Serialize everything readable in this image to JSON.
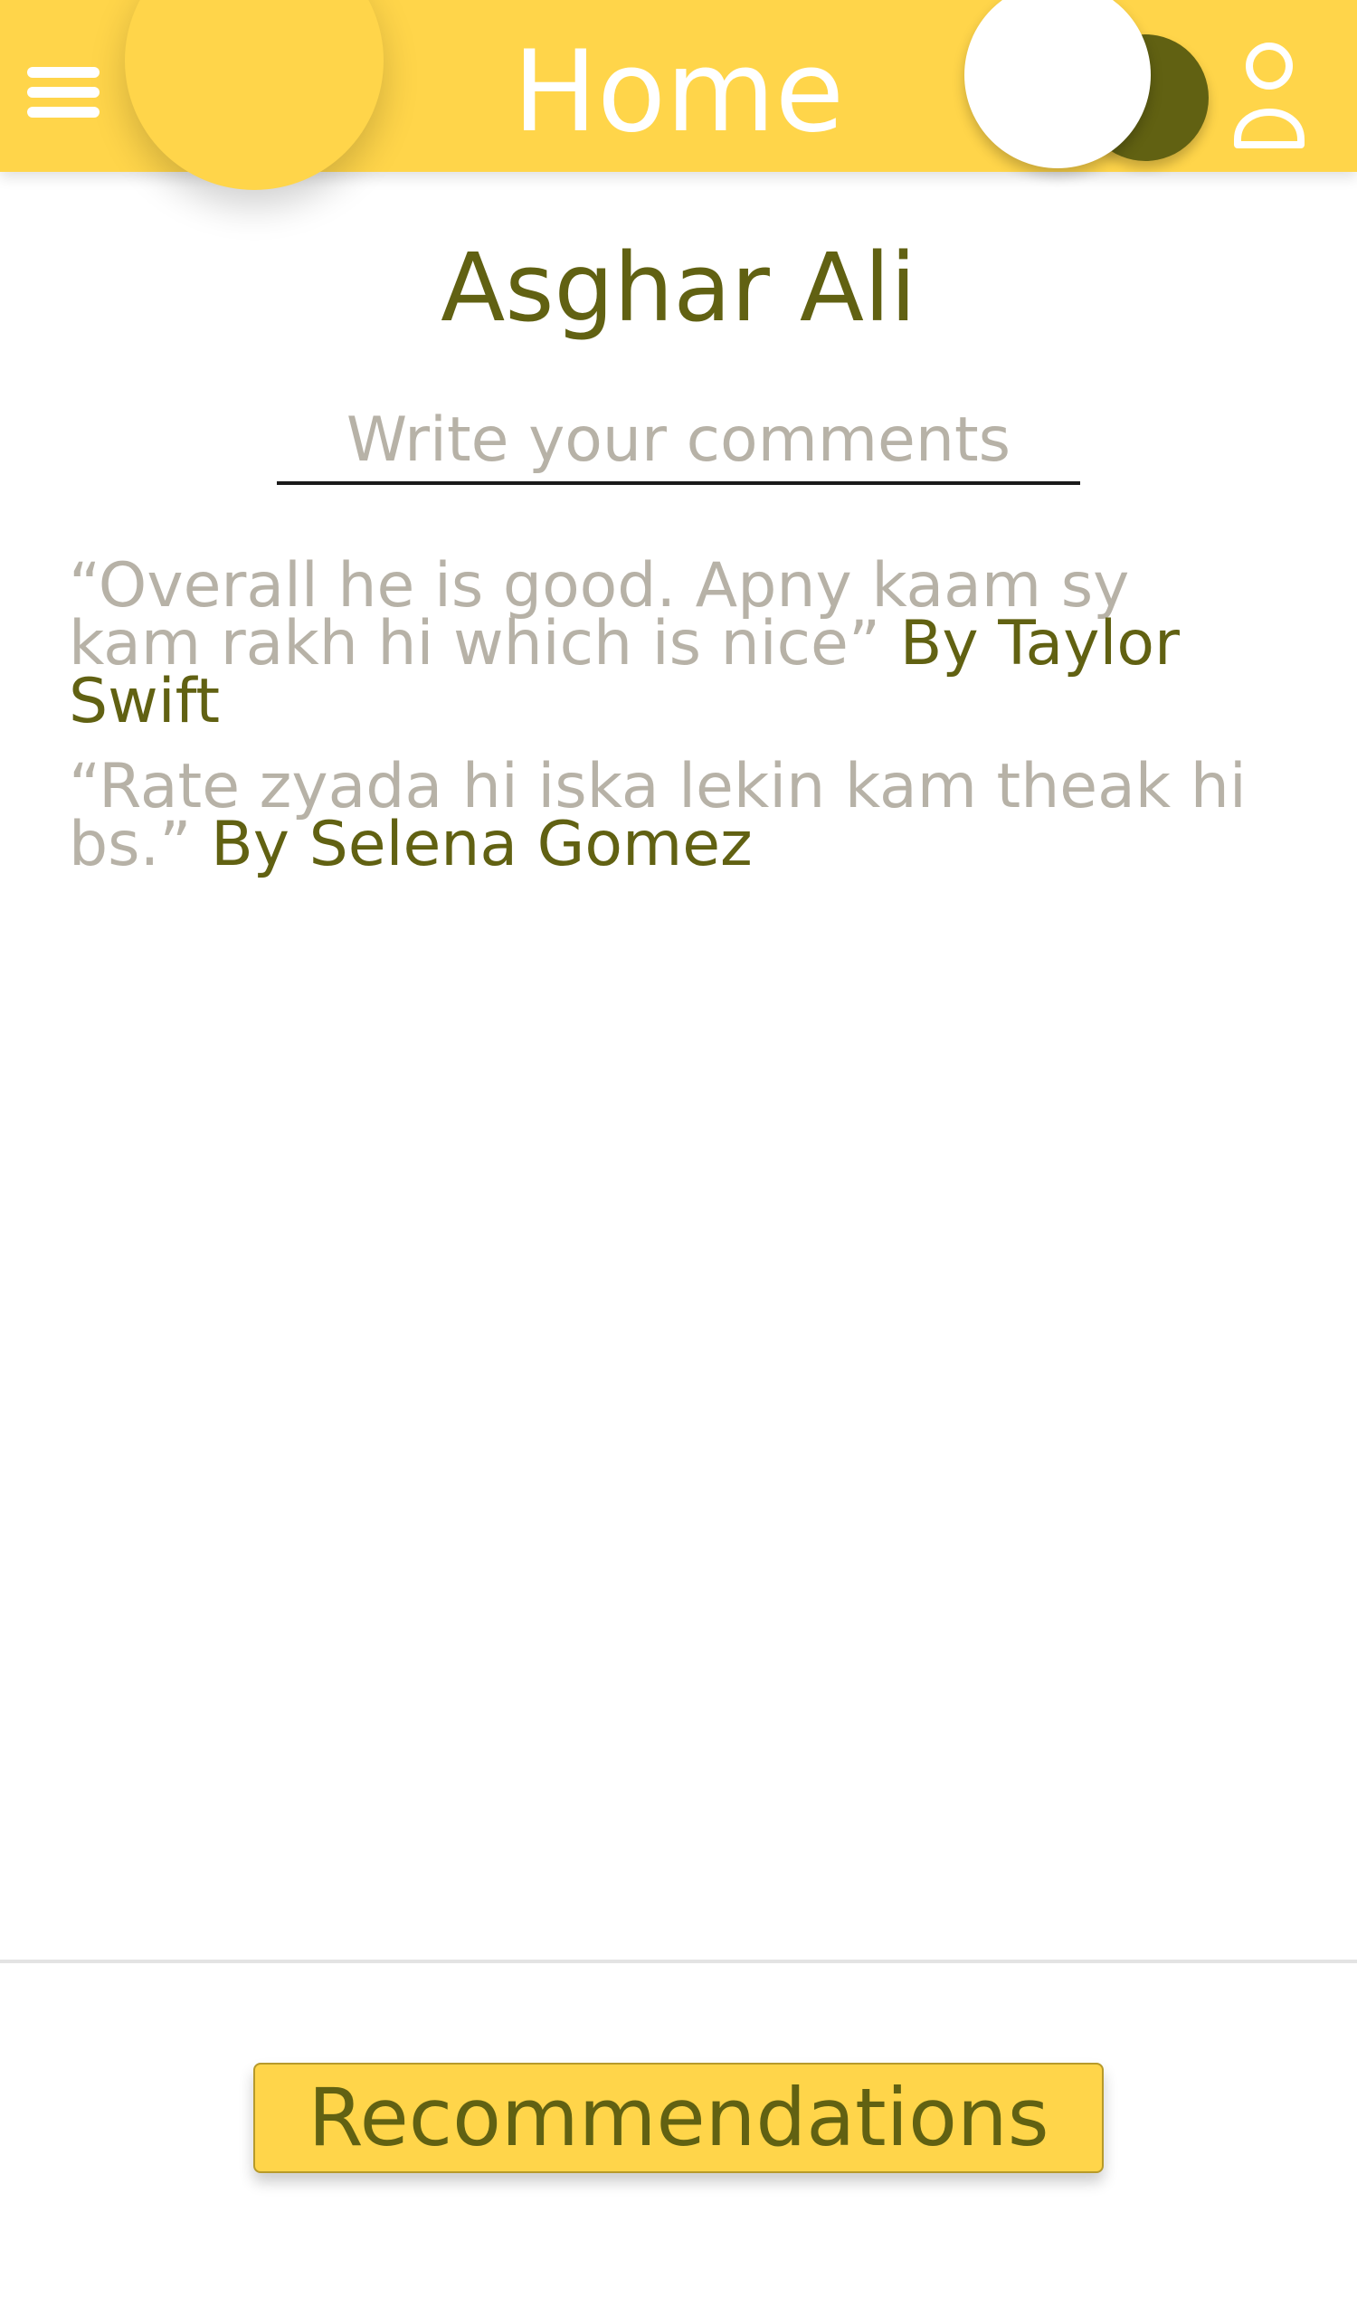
{
  "header": {
    "title": "Home",
    "menu_icon": "menu-icon",
    "toggle_icon": "theme-toggle-icon",
    "profile_icon": "profile-icon"
  },
  "profile": {
    "name": "Asghar Ali"
  },
  "comment_input": {
    "placeholder": "Write your comments",
    "value": ""
  },
  "comments": [
    {
      "text": "“Overall he is good. Apny kaam sy kam rakh hi which is nice”",
      "author": "By Taylor Swift"
    },
    {
      "text": "“Rate zyada hi iska lekin kam theak hi bs.”",
      "author": "By Selena Gomez"
    }
  ],
  "footer": {
    "recommendations_label": "Recommendations"
  },
  "colors": {
    "primary": "#FFD54A",
    "accent": "#616112",
    "muted_text": "#B7B2A7",
    "background": "#FFFFFF"
  }
}
